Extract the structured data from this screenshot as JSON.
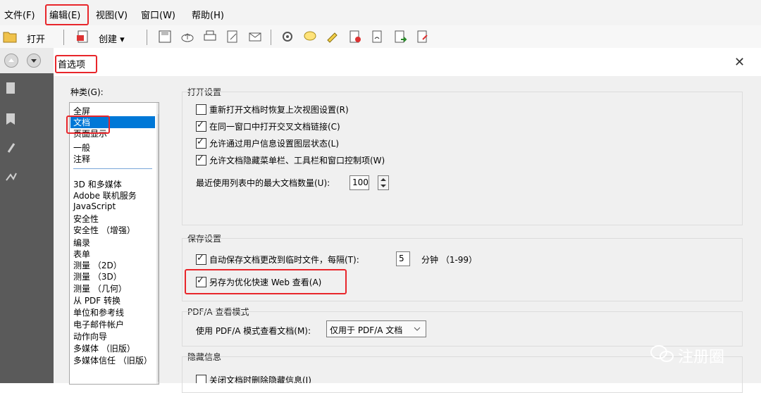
{
  "menubar": {
    "items": [
      "文件(F)",
      "编辑(E)",
      "视图(V)",
      "窗口(W)",
      "帮助(H)"
    ]
  },
  "toolbar": {
    "open_label": "打开",
    "create_label": "创建 ▾"
  },
  "dialog": {
    "title": "首选项",
    "close_glyph": "✕",
    "categories_label": "种类(G):",
    "categories_top": [
      "全屏",
      "文档",
      "页面显示",
      "一般",
      "注释"
    ],
    "selected_category": "文档",
    "categories_bottom": [
      "3D 和多媒体",
      "Adobe 联机服务",
      "JavaScript",
      "安全性",
      "安全性 （增强）",
      "编录",
      "表单",
      "测量 （2D）",
      "测量 （3D）",
      "测量 （几何）",
      "从 PDF 转换",
      "单位和参考线",
      "电子邮件帐户",
      "动作向导",
      "多媒体 （旧版）",
      "多媒体信任 （旧版）"
    ],
    "open_settings": {
      "title": "打开设置",
      "options": [
        {
          "label": "重新打开文档时恢复上次视图设置(R)",
          "checked": false
        },
        {
          "label": "在同一窗口中打开交叉文档链接(C)",
          "checked": true
        },
        {
          "label": "允许通过用户信息设置图层状态(L)",
          "checked": true
        },
        {
          "label": "允许文档隐藏菜单栏、工具栏和窗口控制项(W)",
          "checked": true
        }
      ],
      "recent_label": "最近使用列表中的最大文档数量(U):",
      "recent_value": "100"
    },
    "save_settings": {
      "title": "保存设置",
      "autosave_label": "自动保存文档更改到临时文件，每隔(T):",
      "autosave_value": "5",
      "autosave_unit": "分钟 （1-99）",
      "fastweb_label": "另存为优化快速 Web 查看(A)"
    },
    "pdfa": {
      "title": "PDF/A 查看模式",
      "label": "使用 PDF/A 模式查看文档(M):",
      "value": "仅用于 PDF/A 文档"
    },
    "hidden_info": {
      "title": "隐藏信息",
      "partial_label": "关闭文档时删除隐藏信息(I)"
    }
  },
  "watermark": "注册圈"
}
